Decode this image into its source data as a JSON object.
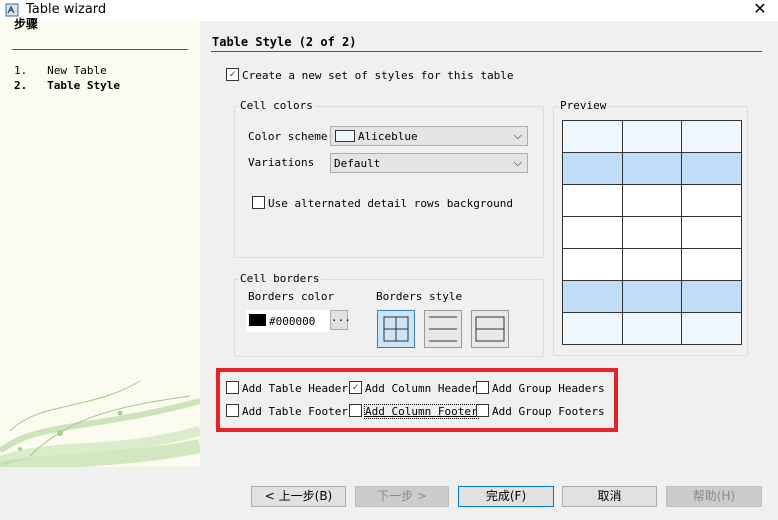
{
  "window": {
    "title": "Table wizard",
    "close_glyph": "✕"
  },
  "steps": {
    "heading": "步骤",
    "items": [
      {
        "number": "1.",
        "label": "New Table",
        "active": false
      },
      {
        "number": "2.",
        "label": "Table Style",
        "active": true
      }
    ]
  },
  "page": {
    "heading": "Table Style (2 of 2)",
    "create_styles": {
      "label": "Create a new set of styles for this table",
      "checked": true
    },
    "cell_colors": {
      "label": "Cell colors",
      "color_scheme_label": "Color scheme",
      "color_scheme_value": "Aliceblue",
      "variations_label": "Variations",
      "variations_value": "Default",
      "alternate_label": "Use alternated detail rows background",
      "alternate_checked": false
    },
    "cell_borders": {
      "label": "Cell borders",
      "color_label": "Borders color",
      "color_value": "#000000",
      "swatch_color": "#000000",
      "browse_label": "...",
      "style_label": "Borders style"
    },
    "preview": {
      "label": "Preview",
      "light_color": "#f0f8ff",
      "dark_color": "#bfdcf8",
      "rows": [
        "light",
        "dark",
        "white",
        "white",
        "white",
        "dark",
        "light"
      ]
    },
    "options": [
      {
        "label": "Add Table Header",
        "checked": false
      },
      {
        "label": "Add Column Header",
        "checked": true
      },
      {
        "label": "Add Group Headers",
        "checked": false
      },
      {
        "label": "Add Table Footer",
        "checked": false
      },
      {
        "label": "Add Column Footer",
        "checked": false
      },
      {
        "label": "Add Group Footers",
        "checked": false
      }
    ],
    "highlight_color": "#e8242b"
  },
  "buttons": {
    "back": "< 上一步(B)",
    "next": "下一步 >",
    "finish": "完成(F)",
    "cancel": "取消",
    "help": "帮助(H)"
  }
}
